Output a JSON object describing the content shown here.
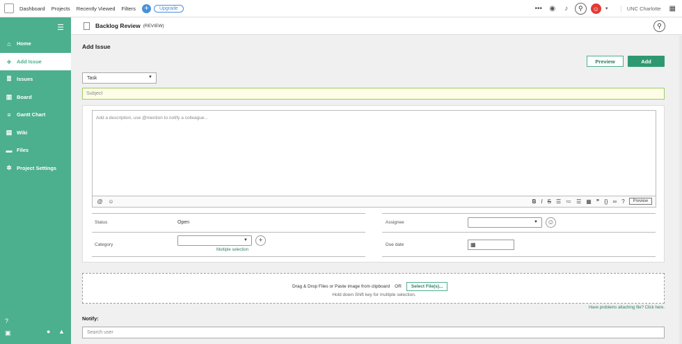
{
  "topbar": {
    "nav": [
      "Dashboard",
      "Projects",
      "Recently Viewed",
      "Filters"
    ],
    "upgrade_label": "Upgrade",
    "org_name": "UNC Charlotte"
  },
  "sidebar": {
    "items": [
      {
        "label": "Home",
        "icon": "home-icon"
      },
      {
        "label": "Add Issue",
        "icon": "plus-icon"
      },
      {
        "label": "Issues",
        "icon": "list-icon"
      },
      {
        "label": "Board",
        "icon": "board-icon"
      },
      {
        "label": "Gantt Chart",
        "icon": "gantt-icon"
      },
      {
        "label": "Wiki",
        "icon": "wiki-icon"
      },
      {
        "label": "Files",
        "icon": "folder-icon"
      },
      {
        "label": "Project Settings",
        "icon": "gear-icon"
      }
    ],
    "active_index": 1
  },
  "header": {
    "project_name": "Backlog Review",
    "project_key": "(REVIEW)"
  },
  "form": {
    "title": "Add Issue",
    "preview_label": "Preview",
    "add_label": "Add",
    "issue_type": "Task",
    "subject_placeholder": "Subject",
    "description_placeholder": "Add a description, use @mention to notify a colleague...",
    "toolbar_preview_label": "Preview",
    "status_label": "Status",
    "status_value": "Open",
    "category_label": "Category",
    "multiple_selection": "Multiple selection",
    "assignee_label": "Assignee",
    "due_date_label": "Due date",
    "dropzone_text": "Drag & Drop Files or Paste image from clipboard",
    "or_text": "OR",
    "select_files_label": "Select File(s)...",
    "dropzone_hint": "Hold down Shift key for multiple selection.",
    "problems_link": "Have problems attaching file? Click here.",
    "notify_label": "Notify:",
    "search_user_placeholder": "Search user"
  },
  "colors": {
    "sidebar": "#4caf8e",
    "accent": "#2e9970",
    "subject_bg": "#fdfde8"
  }
}
